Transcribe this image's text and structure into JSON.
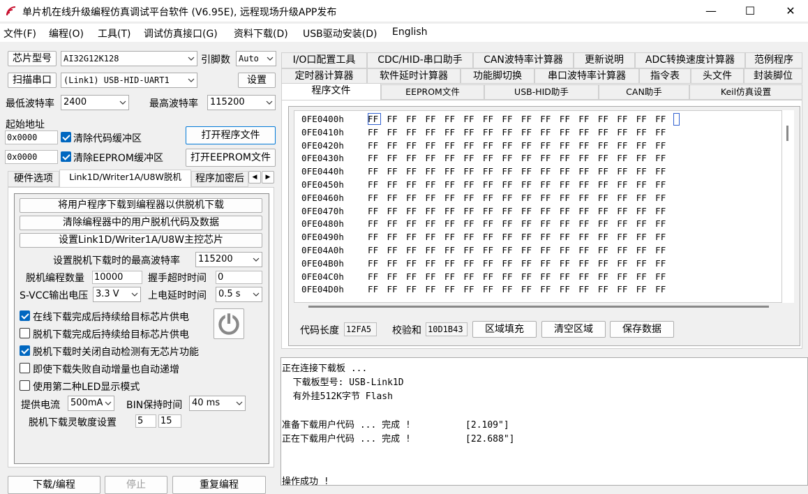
{
  "window": {
    "title": "单片机在线升级编程仿真调试平台软件 (V6.95E), 远程现场升级APP发布",
    "minimize": "—",
    "maximize": "☐",
    "close": "✕"
  },
  "menu": [
    "文件(F)",
    "编程(O)",
    "工具(T)",
    "调试仿真接口(G)",
    "资料下载(D)",
    "USB驱动安装(D)",
    "English"
  ],
  "left": {
    "chip_type_button": "芯片型号",
    "chip_type_value": "AI32G12K128",
    "pin_count_label": "引脚数",
    "pin_count_value": "Auto",
    "scan_port_button": "扫描串口",
    "port_value": "(Link1) USB-HID-UART1",
    "settings_button": "设置",
    "min_baud_label": "最低波特率",
    "min_baud_value": "2400",
    "max_baud_label": "最高波特率",
    "max_baud_value": "115200",
    "start_addr_label": "起始地址",
    "code_addr": "0x0000",
    "clear_code_buffer": "清除代码缓冲区",
    "open_program_button": "打开程序文件",
    "eeprom_addr": "0x0000",
    "clear_eeprom_buffer": "清除EEPROM缓冲区",
    "open_eeprom_button": "打开EEPROM文件",
    "tabs": [
      "硬件选项",
      "Link1D/Writer1A/U8W脱机",
      "程序加密后"
    ],
    "tab_scroll_left": "◀",
    "tab_scroll_right": "▶",
    "offline": {
      "download_to_programmer": "将用户程序下载到编程器以供脱机下载",
      "clear_programmer_code": "清除编程器中的用户脱机代码及数据",
      "set_master_chip": "设置Link1D/Writer1A/U8W主控芯片",
      "max_baud_label": "设置脱机下载时的最高波特率",
      "max_baud_value": "115200",
      "program_count_label": "脱机编程数量",
      "program_count_value": "10000",
      "handshake_timeout_label": "握手超时时间",
      "handshake_timeout_value": "0",
      "svcc_label": "S-VCC输出电压",
      "svcc_value": "3.3 V",
      "power_delay_label": "上电延时时间",
      "power_delay_value": "0.5 s",
      "check1": "在线下载完成后持续给目标芯片供电",
      "check2": "脱机下载完成后持续给目标芯片供电",
      "check3": "脱机下载时关闭自动检测有无芯片功能",
      "check4": "即使下载失败自动增量也自动递增",
      "check5": "使用第二种LED显示模式",
      "supply_current_label": "提供电流",
      "supply_current_value": "500mA",
      "bin_hold_label": "BIN保持时间",
      "bin_hold_value": "40 ms",
      "sensitivity_label": "脱机下载灵敏度设置",
      "sensitivity_a": "5",
      "sensitivity_b": "15"
    },
    "bottom_buttons": [
      "下载/编程",
      "停止",
      "重复编程"
    ]
  },
  "right": {
    "tabs_row1": [
      "I/O口配置工具",
      "CDC/HID-串口助手",
      "CAN波特率计算器",
      "更新说明",
      "ADC转换速度计算器",
      "范例程序"
    ],
    "tabs_row2": [
      "定时器计算器",
      "软件延时计算器",
      "功能脚切换",
      "串口波特率计算器",
      "指令表",
      "头文件",
      "封装脚位"
    ],
    "tabs_row3": [
      "程序文件",
      "EEPROM文件",
      "USB-HID助手",
      "CAN助手",
      "Keil仿真设置"
    ],
    "hex_rows": [
      {
        "addr": "0FE0400h",
        "bytes": "FF FF FF FF FF FF FF FF FF FF FF FF FF FF FF FF"
      },
      {
        "addr": "0FE0410h",
        "bytes": "FF FF FF FF FF FF FF FF FF FF FF FF FF FF FF FF"
      },
      {
        "addr": "0FE0420h",
        "bytes": "FF FF FF FF FF FF FF FF FF FF FF FF FF FF FF FF"
      },
      {
        "addr": "0FE0430h",
        "bytes": "FF FF FF FF FF FF FF FF FF FF FF FF FF FF FF FF"
      },
      {
        "addr": "0FE0440h",
        "bytes": "FF FF FF FF FF FF FF FF FF FF FF FF FF FF FF FF"
      },
      {
        "addr": "0FE0450h",
        "bytes": "FF FF FF FF FF FF FF FF FF FF FF FF FF FF FF FF"
      },
      {
        "addr": "0FE0460h",
        "bytes": "FF FF FF FF FF FF FF FF FF FF FF FF FF FF FF FF"
      },
      {
        "addr": "0FE0470h",
        "bytes": "FF FF FF FF FF FF FF FF FF FF FF FF FF FF FF FF"
      },
      {
        "addr": "0FE0480h",
        "bytes": "FF FF FF FF FF FF FF FF FF FF FF FF FF FF FF FF"
      },
      {
        "addr": "0FE0490h",
        "bytes": "FF FF FF FF FF FF FF FF FF FF FF FF FF FF FF FF"
      },
      {
        "addr": "0FE04A0h",
        "bytes": "FF FF FF FF FF FF FF FF FF FF FF FF FF FF FF FF"
      },
      {
        "addr": "0FE04B0h",
        "bytes": "FF FF FF FF FF FF FF FF FF FF FF FF FF FF FF FF"
      },
      {
        "addr": "0FE04C0h",
        "bytes": "FF FF FF FF FF FF FF FF FF FF FF FF FF FF FF FF"
      },
      {
        "addr": "0FE04D0h",
        "bytes": "FF FF FF FF FF FF FF FF FF FF FF FF FF FF FF FF"
      }
    ],
    "code_length_label": "代码长度",
    "code_length_value": "12FA5",
    "checksum_label": "校验和",
    "checksum_value": "10D1B43",
    "fill_button": "区域填充",
    "clear_button": "清空区域",
    "save_button": "保存数据"
  },
  "log": [
    "正在连接下载板 ...",
    "  下载板型号: USB-Link1D",
    "  有外挂512K字节 Flash",
    "",
    "准备下载用户代码 ... 完成 !          [2.109\"]",
    "正在下载用户代码 ... 完成 !          [22.688\"]",
    "",
    "",
    "操作成功 !"
  ]
}
